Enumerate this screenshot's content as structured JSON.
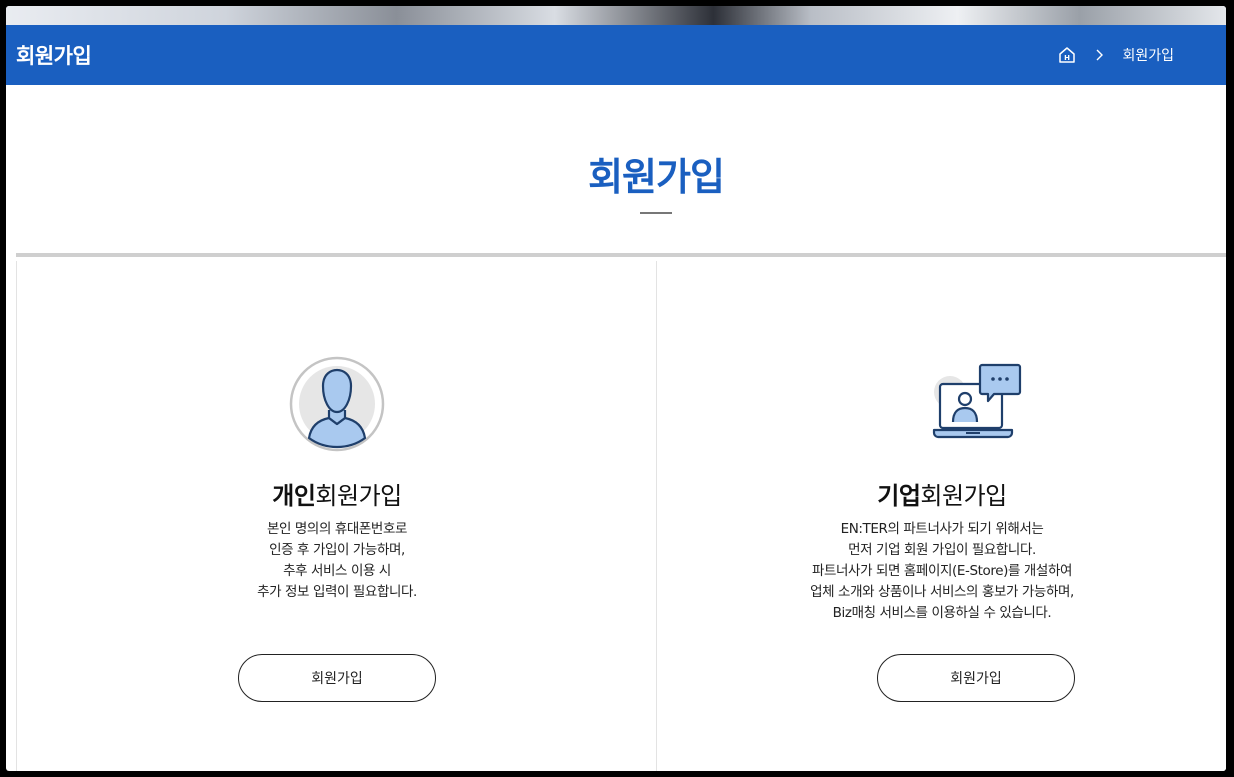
{
  "header": {
    "title": "회원가입",
    "breadcrumb": {
      "home_icon": "home-icon",
      "current": "회원가입"
    }
  },
  "main": {
    "heading": "회원가입",
    "cards": [
      {
        "icon": "user-avatar-icon",
        "title_bold": "개인",
        "title_rest": "회원가입",
        "description": [
          "본인 명의의 휴대폰번호로",
          "인증 후 가입이 가능하며,",
          "추후 서비스 이용 시",
          "추가 정보 입력이 필요합니다."
        ],
        "button_label": "회원가입"
      },
      {
        "icon": "laptop-chat-icon",
        "title_bold": "기업",
        "title_rest": "회원가입",
        "description": [
          "EN:TER의 파트너사가 되기 위해서는",
          "먼저 기업 회원 가입이 필요합니다.",
          "파트너사가 되면 홈페이지(E-Store)를 개설하여",
          "업체 소개와 상품이나 서비스의 홍보가 가능하며,",
          "Biz매칭 서비스를 이용하실 수 있습니다."
        ],
        "button_label": "회원가입"
      }
    ]
  },
  "colors": {
    "brand_blue": "#1a5fc0",
    "icon_blue": "#a9c9ef",
    "icon_outline": "#1f3f6b"
  }
}
